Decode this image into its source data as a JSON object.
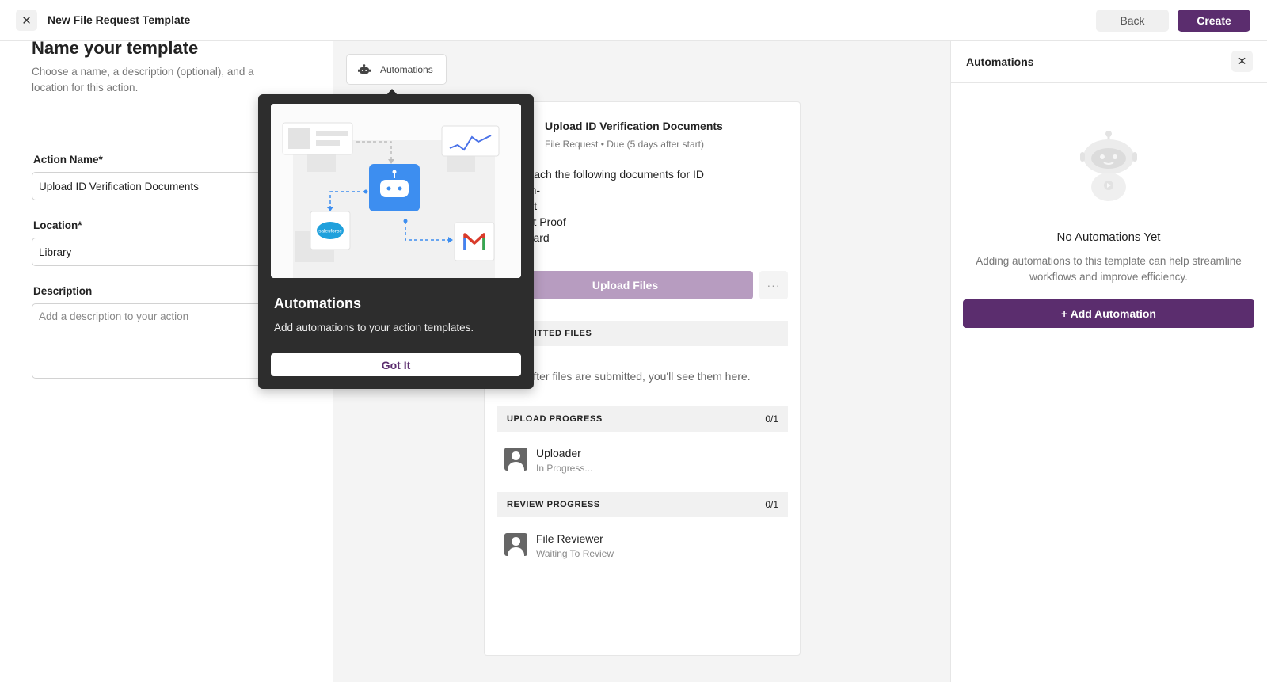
{
  "topbar": {
    "close_glyph": "✕",
    "title": "New File Request Template",
    "back_label": "Back",
    "create_label": "Create"
  },
  "form": {
    "heading": "Name your template",
    "subtitle": "Choose a name, a description (optional), and a location for this action.",
    "action_name_label": "Action Name*",
    "action_name_value": "Upload ID Verification Documents",
    "location_label": "Location*",
    "location_value": "Library",
    "description_label": "Description",
    "description_placeholder": "Add a description to your action"
  },
  "preview": {
    "automations_tab_label": "Automations",
    "title": "Upload ID Verification Documents",
    "meta": "File Request • Due (5 days after start)",
    "body_lines": [
      "se attach the following documents for ID",
      "cation-",
      "ssport",
      "sident Proof",
      "AN Card"
    ],
    "upload_button": "Upload Files",
    "more_glyph": "···",
    "submitted_files_header": "SUBMITTED FILES",
    "empty_submitted": "After files are submitted, you'll see them here.",
    "upload_progress": {
      "label": "UPLOAD PROGRESS",
      "count": "0/1"
    },
    "uploader": {
      "name": "Uploader",
      "status": "In Progress..."
    },
    "review_progress": {
      "label": "REVIEW PROGRESS",
      "count": "0/1"
    },
    "reviewer": {
      "name": "File Reviewer",
      "status": "Waiting To Review"
    }
  },
  "popover": {
    "title": "Automations",
    "description": "Add automations to your action templates.",
    "button": "Got It",
    "illustration_logos": [
      "salesforce",
      "gmail"
    ]
  },
  "right_panel": {
    "title": "Automations",
    "close_glyph": "✕",
    "empty_title": "No Automations Yet",
    "empty_description": "Adding automations to this template can help streamline workflows and improve efficiency.",
    "add_button": "+  Add Automation"
  },
  "colors": {
    "brand": "#5b2d6e",
    "brand_disabled": "#b79cc0",
    "popover_bg": "#2d2d2d",
    "robot_blue": "#3d8ef0"
  }
}
